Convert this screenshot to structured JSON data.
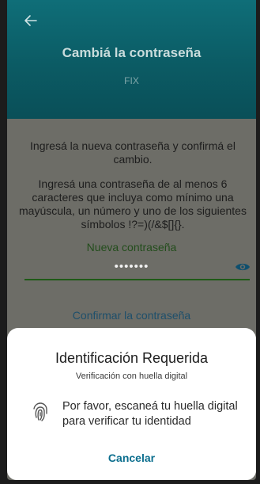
{
  "header": {
    "title": "Cambiá la contraseña",
    "subtitle": "FIX",
    "back_icon": "arrow-left-icon"
  },
  "form": {
    "instruction": "Ingresá la nueva contraseña y confirmá el cambio.",
    "requirements": "Ingresá una contraseña de al menos 6 caracteres que incluya como mínimo una mayúscula, un número y uno de los siguientes símbolos !?=)(/&$[]{}.",
    "new_password_label": "Nueva contraseña",
    "new_password_value": "•••••••",
    "show_password_icon": "eye-icon",
    "confirm_password_label": "Confirmar la contraseña"
  },
  "dialog": {
    "title": "Identificación Requerida",
    "subtitle": "Verificación con huella digital",
    "message": "Por favor, escaneá tu huella digital para verificar tu identidad",
    "fingerprint_icon": "fingerprint-icon",
    "cancel_label": "Cancelar"
  },
  "colors": {
    "header": "#0f6e78",
    "accent_green": "#1f5a17",
    "cancel_blue": "#0b6e8e"
  }
}
